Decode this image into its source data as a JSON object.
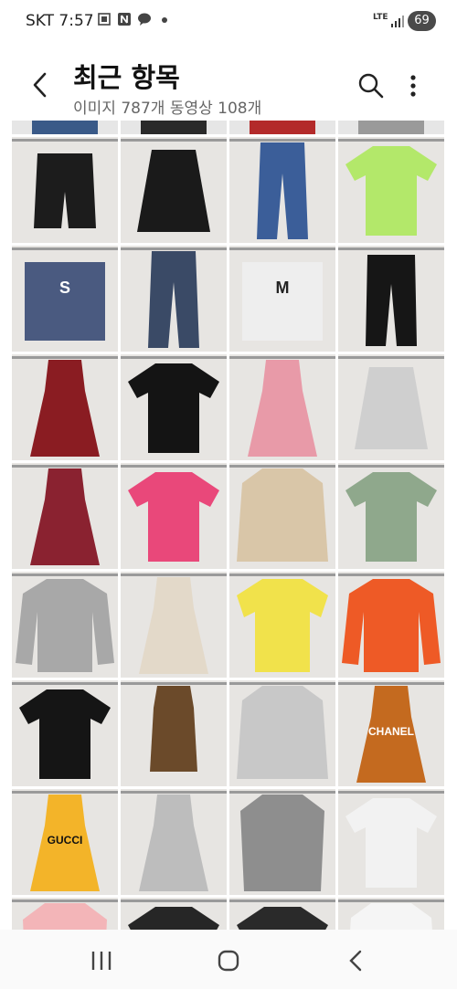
{
  "status_bar": {
    "carrier_time": "SKT 7:57",
    "notification_icons": [
      "screenshot-icon",
      "naver-icon",
      "kakaotalk-icon",
      "dot-icon"
    ],
    "network": "LTE",
    "battery": "69"
  },
  "header": {
    "title": "최근 항목",
    "subtitle": "이미지 787개 동영상 108개"
  },
  "grid": {
    "columns": 4,
    "items": [
      {
        "label": "",
        "color": "#1c1c1c",
        "type": "shorts"
      },
      {
        "label": "",
        "color": "#1a1a1a",
        "type": "skirt"
      },
      {
        "label": "",
        "color": "#3b5e99",
        "type": "jeans"
      },
      {
        "label": "",
        "color": "#b3e86a",
        "type": "tshirt"
      },
      {
        "label": "S",
        "color": "#4a5a80",
        "type": "tag"
      },
      {
        "label": "",
        "color": "#3a4a66",
        "type": "jeans"
      },
      {
        "label": "M",
        "color": "#eeeeee",
        "type": "tag"
      },
      {
        "label": "",
        "color": "#161616",
        "type": "pants"
      },
      {
        "label": "",
        "color": "#8a1c22",
        "type": "dress"
      },
      {
        "label": "",
        "color": "#141414",
        "type": "tshirt"
      },
      {
        "label": "",
        "color": "#e89aa8",
        "type": "dress"
      },
      {
        "label": "",
        "color": "#cfcfcf",
        "type": "skirt"
      },
      {
        "label": "",
        "color": "#8a2230",
        "type": "dress"
      },
      {
        "label": "",
        "color": "#e9487a",
        "type": "tshirt"
      },
      {
        "label": "",
        "color": "#d9c6a8",
        "type": "jacket"
      },
      {
        "label": "",
        "color": "#8fa88c",
        "type": "tshirt"
      },
      {
        "label": "",
        "color": "#a8a8a8",
        "type": "sweater"
      },
      {
        "label": "",
        "color": "#e3d9c9",
        "type": "dress"
      },
      {
        "label": "",
        "color": "#f1e24b",
        "type": "shirt"
      },
      {
        "label": "",
        "color": "#ee5a26",
        "type": "sweater"
      },
      {
        "label": "",
        "color": "#151515",
        "type": "tshirt"
      },
      {
        "label": "",
        "color": "#6b4a2a",
        "type": "top"
      },
      {
        "label": "",
        "color": "#c8c8c8",
        "type": "jacket"
      },
      {
        "label": "CHANEL",
        "color": "#c46a1f",
        "type": "dress"
      },
      {
        "label": "GUCCI",
        "color": "#f3b429",
        "type": "dress"
      },
      {
        "label": "",
        "color": "#bdbdbd",
        "type": "dress"
      },
      {
        "label": "",
        "color": "#8e8e8e",
        "type": "blouse"
      },
      {
        "label": "",
        "color": "#f2f2f2",
        "type": "tshirt"
      },
      {
        "label": "",
        "color": "#f3b5b8",
        "type": "blouse"
      },
      {
        "label": "",
        "color": "#262626",
        "type": "tshirt"
      },
      {
        "label": "",
        "color": "#2a2a2a",
        "type": "tshirt"
      },
      {
        "label": "",
        "color": "#f5f5f5",
        "type": "jacket"
      }
    ],
    "top_strip_colors": [
      "#3a5a88",
      "#2a2a2a",
      "#b32a2a",
      "#9a9a9a"
    ]
  },
  "nav_bar": {
    "icons": [
      "recents-icon",
      "home-icon",
      "back-icon"
    ]
  }
}
